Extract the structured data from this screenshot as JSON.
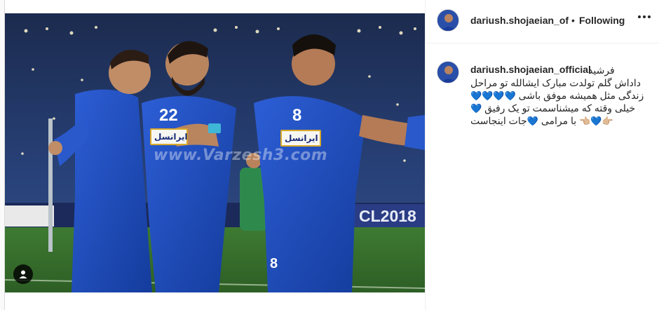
{
  "post": {
    "username": "dariush.shojaeian_offic",
    "separator": "•",
    "follow_status": "Following",
    "more_icon": "more-options-icon"
  },
  "photo": {
    "watermark": "www.Varzesh3.com",
    "board_text": "CL2018",
    "sponsor_left": "ایرانسل",
    "sponsor_mid": "ایرانسل",
    "sponsor_right": "ایرانسل",
    "number_left_player": "22",
    "number_right_player": "8",
    "number_bottom_right": "8",
    "tag_icon": "user-tag-icon"
  },
  "caption": {
    "username": "dariush.shojaeian_official",
    "word_first": "فرشید",
    "line1": "داداش گلم تولدت مبارک ایشالله تو مراحل",
    "line2_text": "زندگی مثل همیشه موفق باشی",
    "line2_emoji": "💙💙💙💙",
    "line3_text": "خیلی وقته که میشناسمت تو یک رفیق",
    "line3_emoji": "💙",
    "line4_part1": "👉🏼💙👈🏼",
    "line4_part2": "با مرامی",
    "line4_emoji": "💙",
    "line4_part3": "جات اینجاست",
    "accent_color": "#2a7bd6"
  }
}
